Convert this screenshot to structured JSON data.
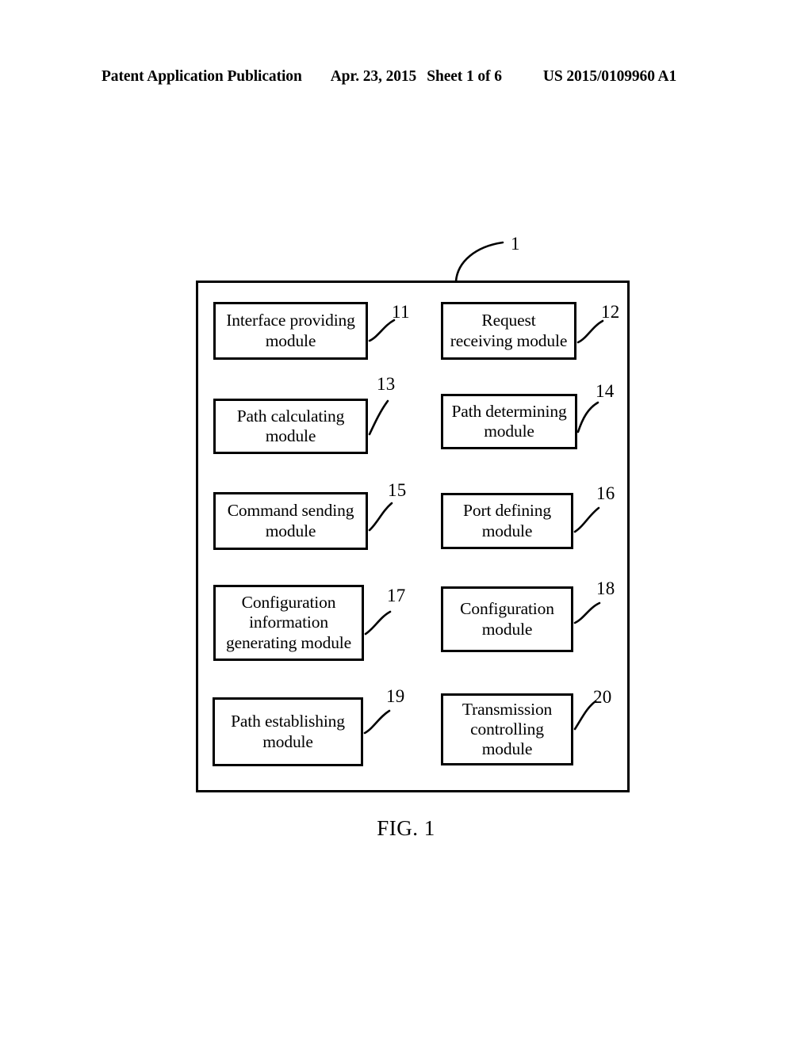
{
  "header": {
    "publication": "Patent Application Publication",
    "date": "Apr. 23, 2015",
    "sheet": "Sheet 1 of 6",
    "publication_number": "US 2015/0109960 A1"
  },
  "figure": {
    "caption": "FIG. 1",
    "container_ref": "1",
    "modules": [
      {
        "ref": "11",
        "label": "Interface providing\nmodule"
      },
      {
        "ref": "12",
        "label": "Request\nreceiving module"
      },
      {
        "ref": "13",
        "label": "Path calculating\nmodule"
      },
      {
        "ref": "14",
        "label": "Path determining\nmodule"
      },
      {
        "ref": "15",
        "label": "Command sending\nmodule"
      },
      {
        "ref": "16",
        "label": "Port defining\nmodule"
      },
      {
        "ref": "17",
        "label": "Configuration\ninformation\ngenerating module"
      },
      {
        "ref": "18",
        "label": "Configuration\nmodule"
      },
      {
        "ref": "19",
        "label": "Path establishing\nmodule"
      },
      {
        "ref": "20",
        "label": "Transmission\ncontrolling\nmodule"
      }
    ]
  },
  "colors": {
    "ink": "#000000",
    "paper": "#ffffff"
  }
}
